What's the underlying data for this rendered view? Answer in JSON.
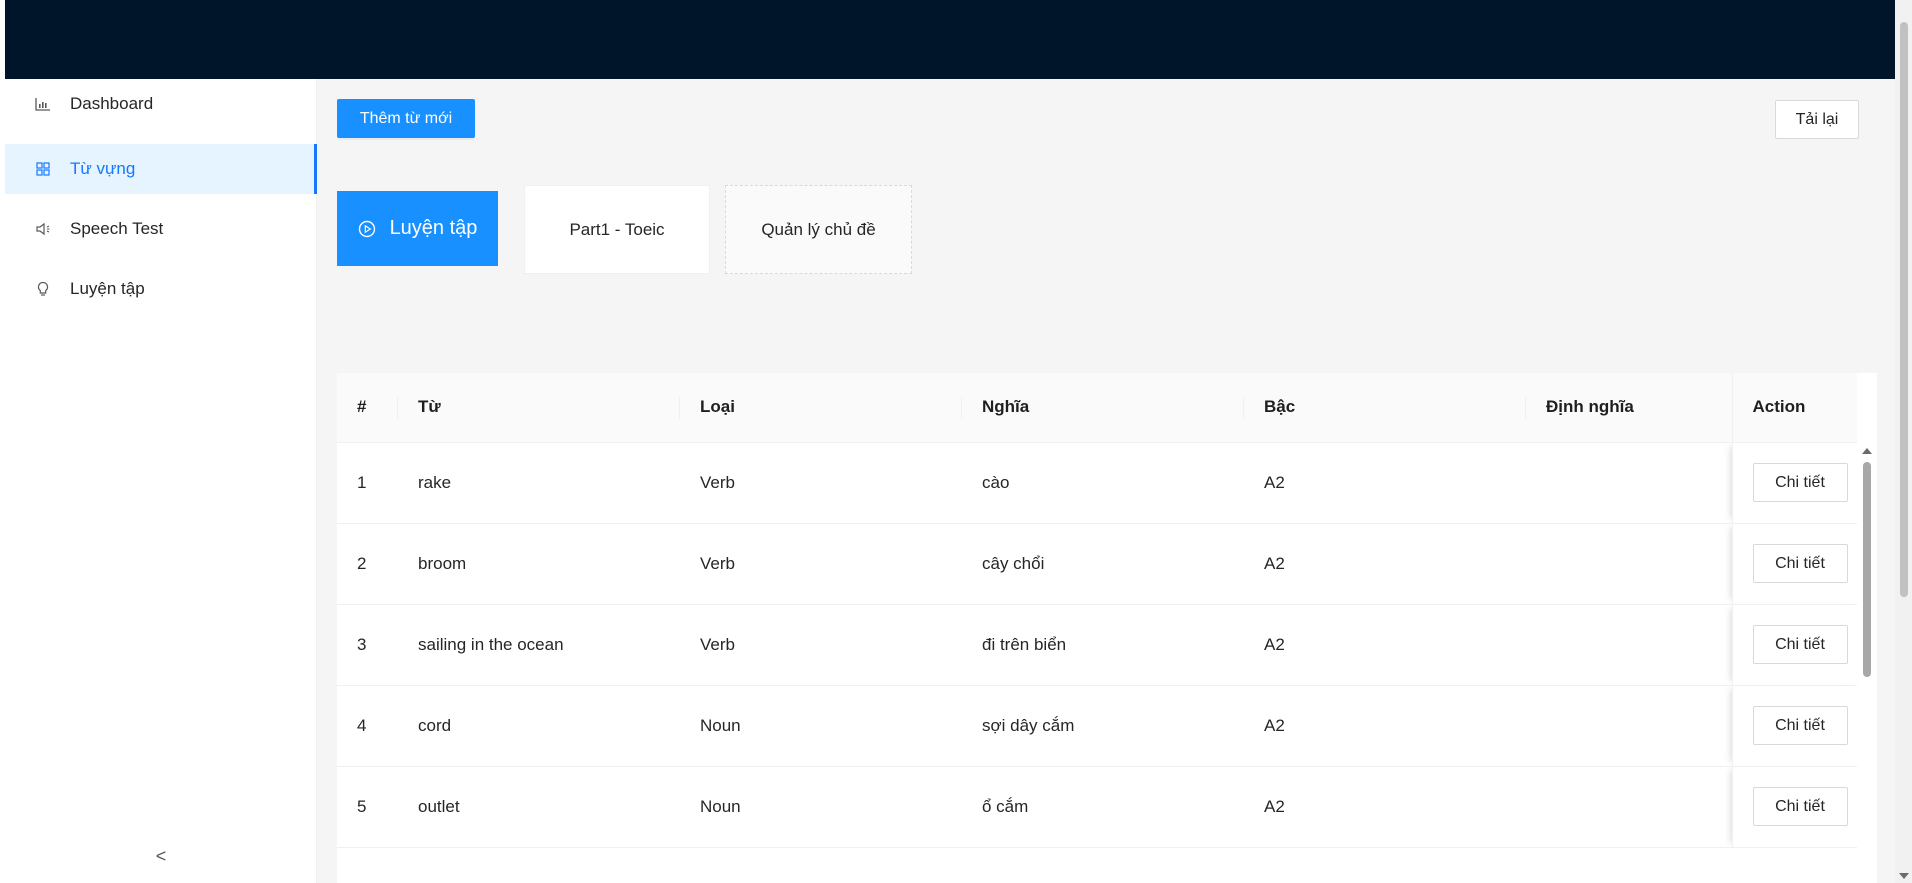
{
  "sidebar": {
    "items": [
      {
        "label": "Dashboard",
        "icon": "bar-chart-icon"
      },
      {
        "label": "Từ vựng",
        "icon": "appstore-icon"
      },
      {
        "label": "Speech Test",
        "icon": "sound-icon"
      },
      {
        "label": "Luyện tập",
        "icon": "bulb-icon"
      }
    ],
    "active_index": 1,
    "collapse_label": "<"
  },
  "toolbar": {
    "add_label": "Thêm từ mới",
    "reload_label": "Tải lại"
  },
  "cards": {
    "practice_label": "Luyện tập",
    "topic_label": "Part1 - Toeic",
    "manage_label": "Quản lý chủ đề"
  },
  "table": {
    "columns": [
      "#",
      "Từ",
      "Loại",
      "Nghĩa",
      "Bậc",
      "Định nghĩa",
      "Action"
    ],
    "detail_label": "Chi tiết",
    "rows": [
      {
        "num": "1",
        "word": "rake",
        "type": "Verb",
        "meaning": "cào",
        "level": "A2",
        "definition": ""
      },
      {
        "num": "2",
        "word": "broom",
        "type": "Verb",
        "meaning": "cây chổi",
        "level": "A2",
        "definition": ""
      },
      {
        "num": "3",
        "word": "sailing in the ocean",
        "type": "Verb",
        "meaning": "đi trên biển",
        "level": "A2",
        "definition": ""
      },
      {
        "num": "4",
        "word": "cord",
        "type": "Noun",
        "meaning": "sợi dây cắm",
        "level": "A2",
        "definition": ""
      },
      {
        "num": "5",
        "word": "outlet",
        "type": "Noun",
        "meaning": "ổ cắm",
        "level": "A2",
        "definition": ""
      }
    ]
  },
  "colors": {
    "header_bg": "#001529",
    "primary": "#1890ff",
    "active_menu_bg": "#e6f4ff"
  }
}
